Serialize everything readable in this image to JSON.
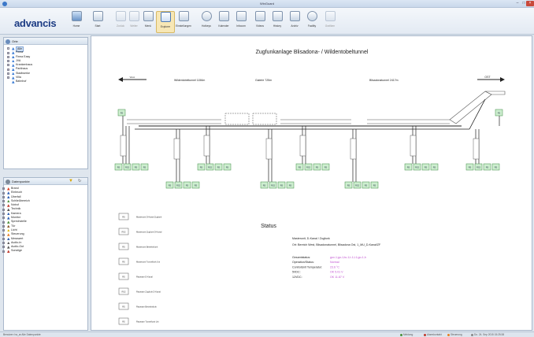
{
  "window": {
    "title": "WinGuard"
  },
  "logo": {
    "text": "advancis"
  },
  "toolbar": [
    {
      "name": "home-button",
      "label": "Home",
      "icon": "house-icon",
      "style": "blue",
      "enabled": true
    },
    {
      "name": "start-button",
      "label": "Start",
      "icon": "start-icon",
      "style": "plain",
      "enabled": true
    },
    {
      "name": "back-button",
      "label": "Zurück",
      "icon": "arrow-left-icon",
      "style": "plain",
      "enabled": false
    },
    {
      "name": "forward-button",
      "label": "Weiter",
      "icon": "arrow-right-icon",
      "style": "plain",
      "enabled": false
    },
    {
      "name": "menu-button",
      "label": "Menü",
      "icon": "menu-icon",
      "style": "plain",
      "enabled": true
    },
    {
      "name": "explorer-button",
      "label": "Explorer",
      "icon": "explorer-icon",
      "style": "sel",
      "enabled": true,
      "active": true
    },
    {
      "name": "settings-button",
      "label": "Einstellungen",
      "icon": "window-icon",
      "style": "plain",
      "enabled": true
    },
    {
      "name": "hotkeys-button",
      "label": "Hotkeys",
      "icon": "globe-icon",
      "style": "round",
      "enabled": true
    },
    {
      "name": "calendar-button",
      "label": "Kalender",
      "icon": "tools-icon",
      "style": "plain",
      "enabled": true
    },
    {
      "name": "infocom-button",
      "label": "Infocom",
      "icon": "person-icon",
      "style": "plain",
      "enabled": true
    },
    {
      "name": "videos-button",
      "label": "Videos",
      "icon": "video-icon",
      "style": "plain",
      "enabled": true
    },
    {
      "name": "history-button",
      "label": "History",
      "icon": "chart-icon",
      "style": "plain",
      "enabled": true
    },
    {
      "name": "archive-button",
      "label": "Archiv",
      "icon": "archive-icon",
      "style": "plain",
      "enabled": true
    },
    {
      "name": "facility-button",
      "label": "Facility",
      "icon": "facility-icon",
      "style": "round",
      "enabled": true
    },
    {
      "name": "graphics-button",
      "label": "Grafiken",
      "icon": "graphics-icon",
      "style": "plain",
      "enabled": false
    }
  ],
  "orte_panel": {
    "title": "Orte",
    "items": [
      {
        "label": "Alle",
        "level": 1,
        "selected": true,
        "expand": "-",
        "color": "#3a7bd5"
      },
      {
        "label": "Firma",
        "level": 1,
        "expand": "+",
        "color": "#3a7bd5"
      },
      {
        "label": "Firma Easy",
        "level": 1,
        "expand": "+",
        "color": "#3a7bd5"
      },
      {
        "label": "JVA",
        "level": 1,
        "expand": "+",
        "color": "#3a7bd5"
      },
      {
        "label": "Krankenhaus",
        "level": 1,
        "expand": "+",
        "color": "#3a7bd5"
      },
      {
        "label": "Parkhaus",
        "level": 1,
        "expand": "+",
        "color": "#3a7bd5"
      },
      {
        "label": "Stadtwerke",
        "level": 1,
        "expand": "+",
        "color": "#3a7bd5"
      },
      {
        "label": "Villa",
        "level": 1,
        "expand": "+",
        "color": "#3a7bd5"
      },
      {
        "label": "Bahnhof",
        "level": 1,
        "expand": "",
        "color": "#3a7bd5"
      }
    ]
  },
  "datenpunkte_panel": {
    "title": "Datenpunkte",
    "items": [
      {
        "label": "Brand",
        "expand": "+",
        "color": "#d9381e"
      },
      {
        "label": "Einbruch",
        "expand": "+",
        "color": "#2c5fb3"
      },
      {
        "label": "Überfall",
        "expand": "+",
        "color": "#2c5fb3"
      },
      {
        "label": "Schließbereich",
        "expand": "+",
        "color": "#4a8f3a"
      },
      {
        "label": "Notruf",
        "expand": "+",
        "color": "#c0392b"
      },
      {
        "label": "Technik",
        "expand": "+",
        "color": "#555555"
      },
      {
        "label": "Kamera",
        "expand": "+",
        "color": "#2c5fb3"
      },
      {
        "label": "Monitor",
        "expand": "+",
        "color": "#2c5fb3"
      },
      {
        "label": "Sprechstelle",
        "expand": "+",
        "color": "#4a8f3a"
      },
      {
        "label": "Tür",
        "expand": "+",
        "color": "#8b5a2b"
      },
      {
        "label": "Licht",
        "expand": "+",
        "color": "#e0b400"
      },
      {
        "label": "Steuerung",
        "expand": "+",
        "color": "#e67e22"
      },
      {
        "label": "Messwert",
        "expand": "+",
        "color": "#2c5fb3"
      },
      {
        "label": "Audio-In",
        "expand": "+",
        "color": "#555555"
      },
      {
        "label": "Audio-Out",
        "expand": "+",
        "color": "#555555"
      },
      {
        "label": "Sonstige",
        "expand": "+",
        "color": "#c0392b"
      }
    ]
  },
  "diagram": {
    "title": "Zugfunkanlage Blisadona- / Wildentobeltunnel",
    "west_label": "West",
    "east_label": "OST",
    "tunnel1": "Wildentobeltunnel 1156m",
    "tunnel2": "Galerie 725m",
    "tunnel3": "Blisadonatunnel 2417m",
    "node_labels": [
      "RS",
      "RS2",
      "RS",
      "RS"
    ],
    "legend": [
      {
        "code": "RS",
        "text": "Masterunit D-Kanal Zugfunk"
      },
      {
        "code": "RS2",
        "text": "Masterunit Zugfunk D-Kanal"
      },
      {
        "code": "RS",
        "text": "Masterunit Betriebsfunk"
      },
      {
        "code": "RS",
        "text": "Masterunit Tunnelfunk Uni"
      },
      {
        "code": "RS",
        "text": "Repeater D-Kanal"
      },
      {
        "code": "RS2",
        "text": "Repeater Zugfunk D-Kanal"
      },
      {
        "code": "RS",
        "text": "Repeater Betriebsfunk"
      },
      {
        "code": "RS",
        "text": "Repeater Tunnelfunk Uni"
      }
    ],
    "status": {
      "heading": "Status",
      "line1": "Masterunit, D-Kanal / Zugfunk",
      "line2": "Ort:  Bereich West, Blisadonatunnel, Blisadona Ost, 1_MU_D-Kanal/ZF",
      "rows": [
        {
          "label": "Gesamtstatus:",
          "value": "gov-1;go-1;tu-1;t-1;l-1;go-1;h"
        },
        {
          "label": "Operation/Status:",
          "value": "Normal"
        },
        {
          "label": "ControlUnit Temperatur:",
          "value": "23.6 °C"
        },
        {
          "label": "5VDC:",
          "value": "OK        5.01 V"
        },
        {
          "label": "12VDC:",
          "value": "OK        11.87 V"
        }
      ]
    }
  },
  "statusbar": {
    "left": "Benutzer: ha_ar Alle Datenpunkte",
    "items": [
      {
        "text": "Meldung",
        "color": "#4a8f3a"
      },
      {
        "text": "Alarmkontakt",
        "color": "#c0392b"
      },
      {
        "text": "Steuerung",
        "color": "#e67e22"
      },
      {
        "text": "Do. 24. Sep 2015 15:25:38",
        "color": "#888888"
      }
    ]
  },
  "colors": {
    "node_fill": "#cdeecf",
    "node_stroke": "#3f8a45",
    "status_value": "#c050d0",
    "cable": "#222222"
  }
}
